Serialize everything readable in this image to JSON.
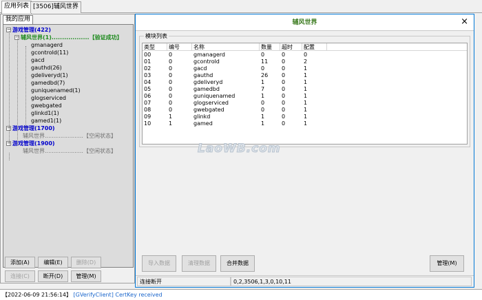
{
  "top_tabs": [
    "应用列表",
    "[3506]辅风世界"
  ],
  "left": {
    "subtab": "我的应用",
    "tree": [
      {
        "label": "游戏管理(422)",
        "type": "group",
        "expanded": true
      },
      {
        "label": "辅风世界(1)..................【验证成功】",
        "type": "ok",
        "expanded": true
      },
      {
        "label": "gmanagerd",
        "type": "leaf"
      },
      {
        "label": "gcontrold(11)",
        "type": "leaf"
      },
      {
        "label": "gacd",
        "type": "leaf"
      },
      {
        "label": "gauthd(26)",
        "type": "leaf"
      },
      {
        "label": "gdeliveryd(1)",
        "type": "leaf"
      },
      {
        "label": "gamedbd(7)",
        "type": "leaf"
      },
      {
        "label": "guniquenamed(1)",
        "type": "leaf"
      },
      {
        "label": "glogserviced",
        "type": "leaf"
      },
      {
        "label": "gwebgated",
        "type": "leaf"
      },
      {
        "label": "glinkd1(1)",
        "type": "leaf"
      },
      {
        "label": "gamed1(1)",
        "type": "leaf"
      },
      {
        "label": "游戏管理(1700)",
        "type": "group",
        "expanded": true
      },
      {
        "label": "辅风世界......................【空闲状态】",
        "type": "idle"
      },
      {
        "label": "游戏管理(1900)",
        "type": "group",
        "expanded": true
      },
      {
        "label": "辅风世界......................【空闲状态】",
        "type": "idle"
      }
    ],
    "buttons": [
      {
        "label": "添加(A)",
        "disabled": false
      },
      {
        "label": "编辑(E)",
        "disabled": false
      },
      {
        "label": "删除(D)",
        "disabled": true
      },
      {
        "label": "连接(C)",
        "disabled": true
      },
      {
        "label": "断开(D)",
        "disabled": false
      },
      {
        "label": "管理(M)",
        "disabled": false
      }
    ]
  },
  "right": {
    "title": "辅风世界",
    "close": "×",
    "group_label": "模块列表",
    "columns": [
      "类型",
      "编号",
      "名称",
      "数量",
      "超时",
      "配置"
    ],
    "rows": [
      [
        "00",
        "0",
        "gmanagerd",
        "0",
        "0",
        "0"
      ],
      [
        "01",
        "0",
        "gcontrold",
        "11",
        "0",
        "2"
      ],
      [
        "02",
        "0",
        "gacd",
        "0",
        "0",
        "1"
      ],
      [
        "03",
        "0",
        "gauthd",
        "26",
        "0",
        "1"
      ],
      [
        "04",
        "0",
        "gdeliveryd",
        "1",
        "0",
        "1"
      ],
      [
        "05",
        "0",
        "gamedbd",
        "7",
        "0",
        "1"
      ],
      [
        "06",
        "0",
        "guniquenamed",
        "1",
        "0",
        "1"
      ],
      [
        "07",
        "0",
        "glogserviced",
        "0",
        "0",
        "1"
      ],
      [
        "08",
        "0",
        "gwebgated",
        "0",
        "0",
        "1"
      ],
      [
        "09",
        "1",
        "glinkd",
        "1",
        "0",
        "1"
      ],
      [
        "10",
        "1",
        "gamed",
        "1",
        "0",
        "1"
      ]
    ],
    "watermark": "LaoWB.com",
    "buttons": [
      {
        "label": "导入数据",
        "disabled": true
      },
      {
        "label": "清理数据",
        "disabled": true
      },
      {
        "label": "合并数据",
        "disabled": false
      },
      {
        "label": "管理(M)",
        "disabled": false
      }
    ],
    "status": [
      "连接断开",
      "0,2,3506,1,3,0,10,11"
    ]
  },
  "log": {
    "time": "【2022-06-09 21:56:14】",
    "tag": "[GVerifyClient]",
    "message": "CertKey received"
  }
}
